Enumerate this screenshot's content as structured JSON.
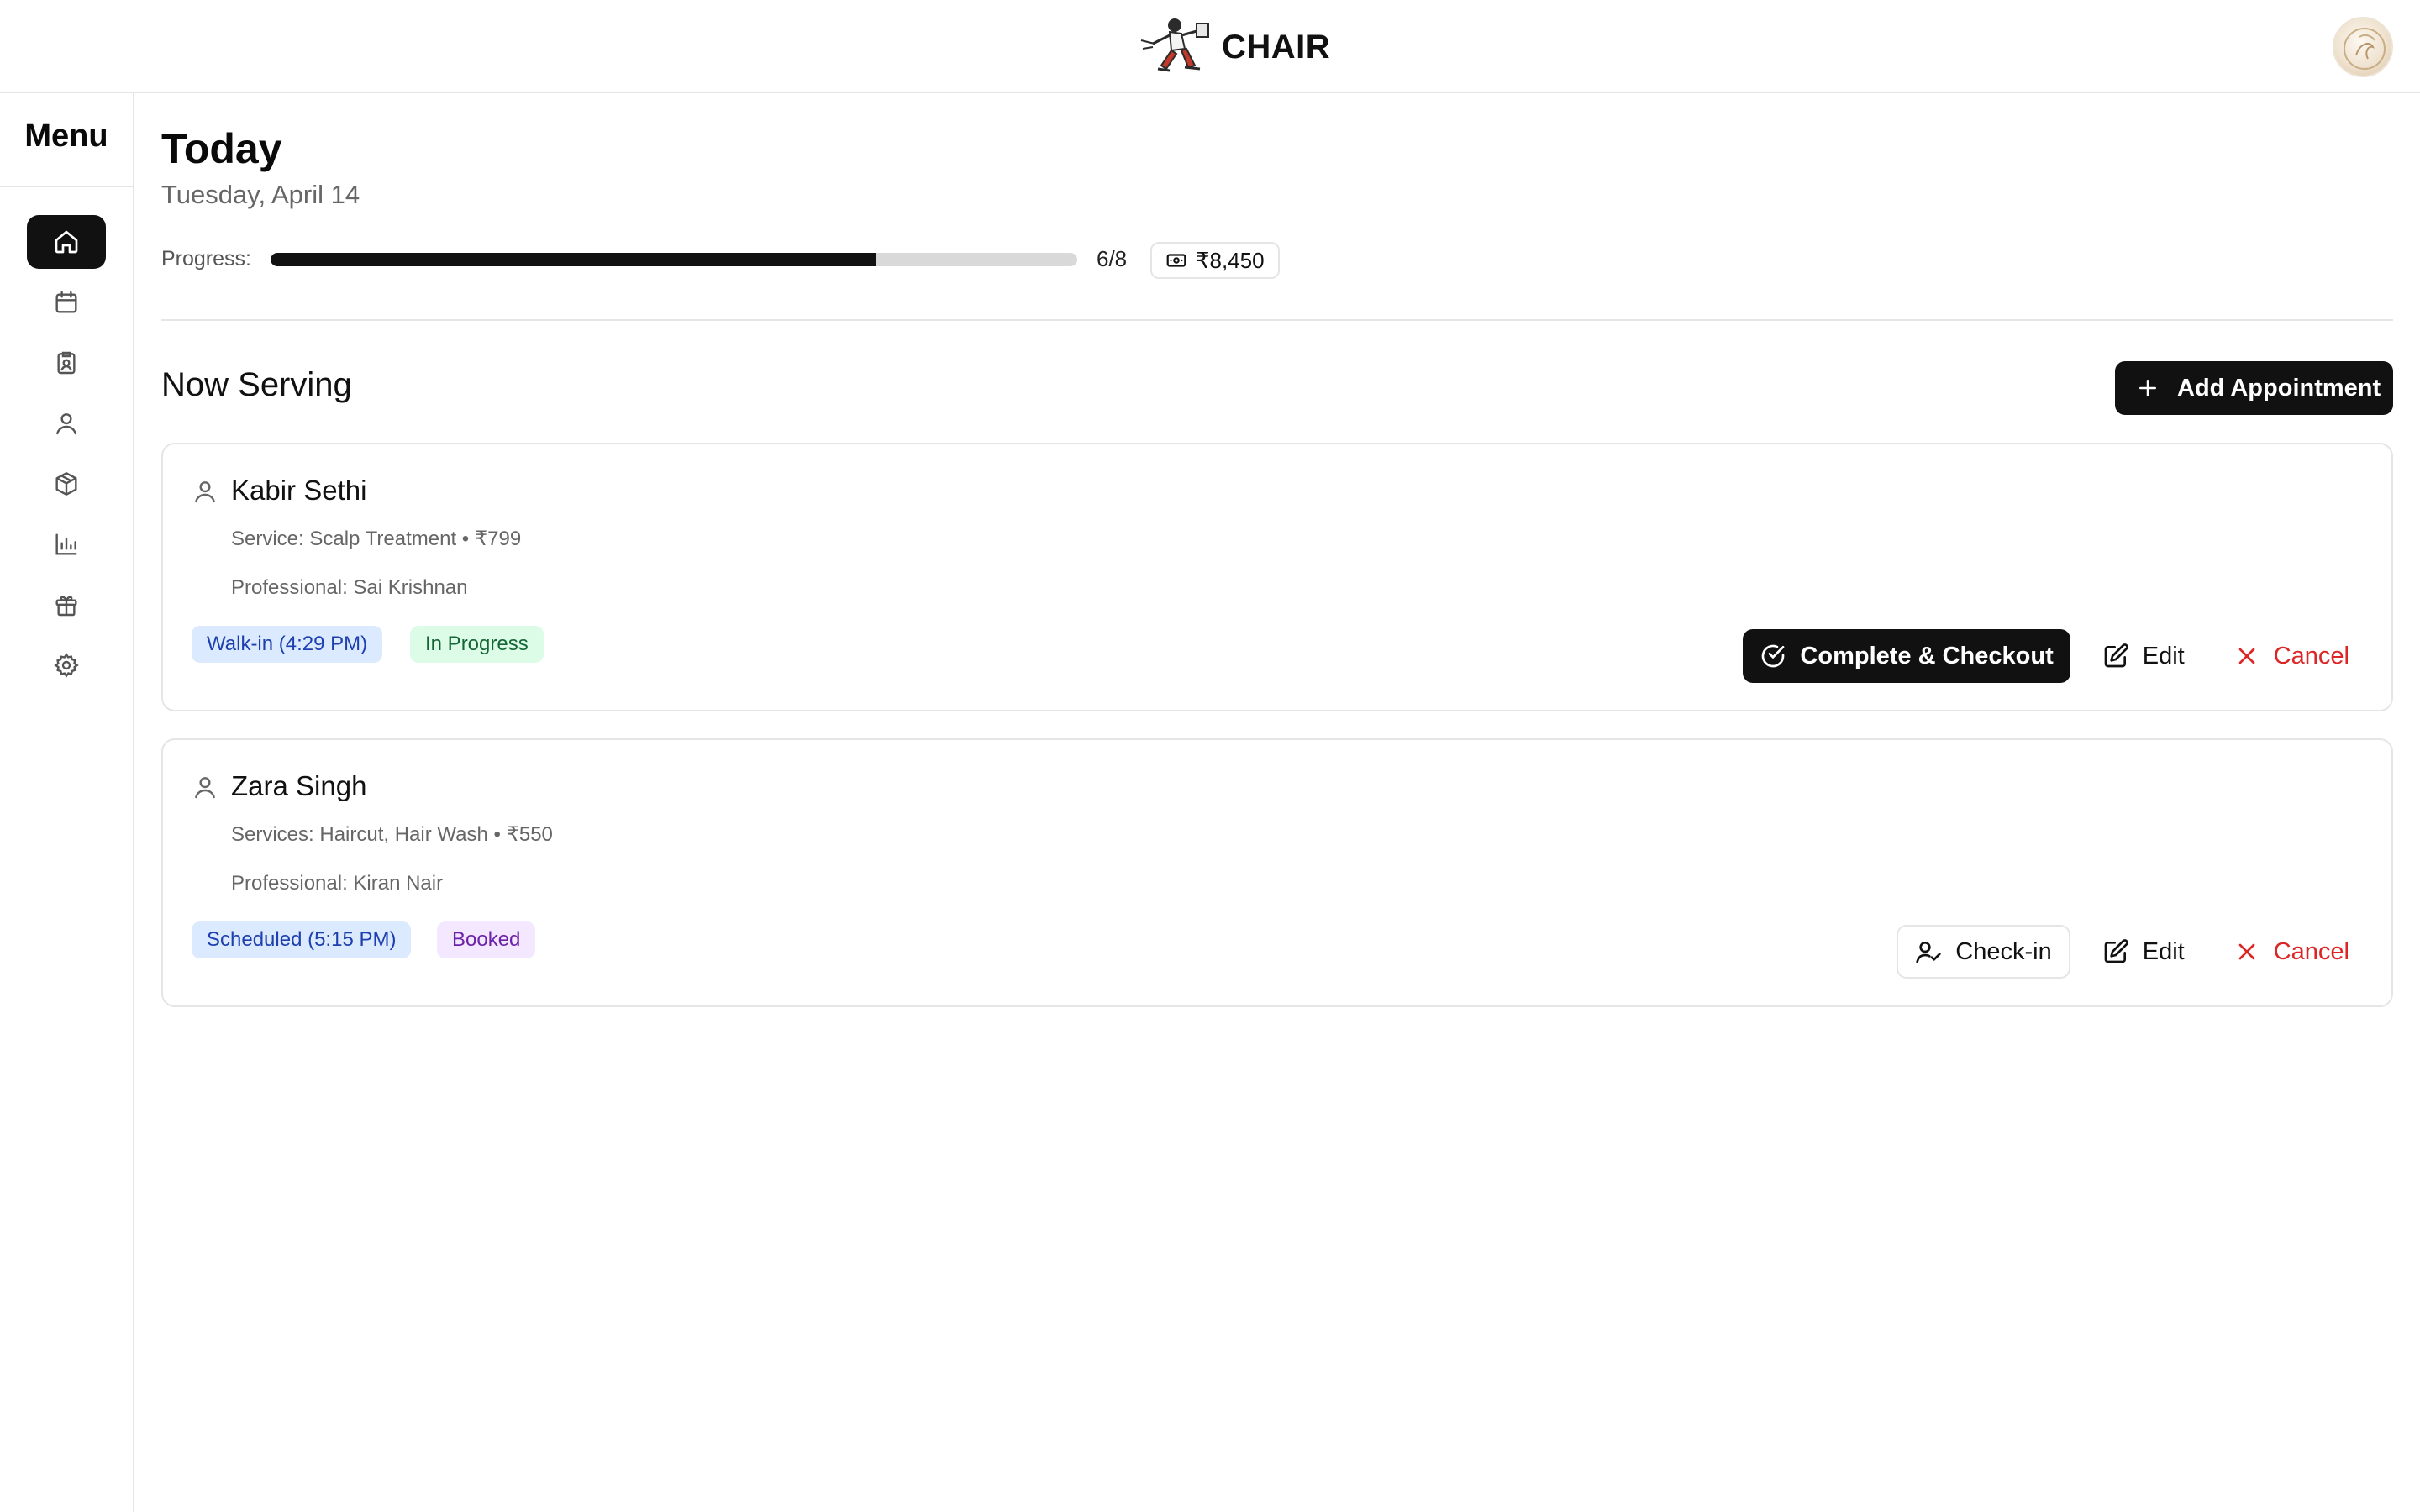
{
  "header": {
    "brand": "CHAIR",
    "logo": "barber-running-logo",
    "avatar": "user-avatar"
  },
  "sidebar": {
    "title": "Menu",
    "items": [
      {
        "icon": "home-icon",
        "active": true
      },
      {
        "icon": "calendar-icon",
        "active": false
      },
      {
        "icon": "clipboard-icon",
        "active": false
      },
      {
        "icon": "user-icon",
        "active": false
      },
      {
        "icon": "box-icon",
        "active": false
      },
      {
        "icon": "bar-chart-icon",
        "active": false
      },
      {
        "icon": "gift-icon",
        "active": false
      },
      {
        "icon": "settings-icon",
        "active": false
      }
    ]
  },
  "today": {
    "title": "Today",
    "date": "Tuesday, April 14",
    "progress_label": "Progress:",
    "progress_fraction": 0.75,
    "progress_count": "6/8",
    "revenue": "₹8,450"
  },
  "now_serving": {
    "title": "Now Serving",
    "add_label": "Add Appointment",
    "cards": [
      {
        "name": "Kabir Sethi",
        "service": "Service: Scalp Treatment • ₹799",
        "professional": "Professional: Sai Krishnan",
        "badge_time": "Walk-in (4:29 PM)",
        "badge_status": "In Progress",
        "primary_label": "Complete & Checkout",
        "edit_label": "Edit",
        "cancel_label": "Cancel"
      },
      {
        "name": "Zara Singh",
        "service": "Services: Haircut, Hair Wash • ₹550",
        "professional": "Professional: Kiran Nair",
        "badge_time": "Scheduled (5:15 PM)",
        "badge_status": "Booked",
        "primary_label": "Check-in",
        "edit_label": "Edit",
        "cancel_label": "Cancel"
      }
    ]
  },
  "colors": {
    "accent": "#111111",
    "danger": "#dc2626",
    "border": "#e5e5e5"
  }
}
